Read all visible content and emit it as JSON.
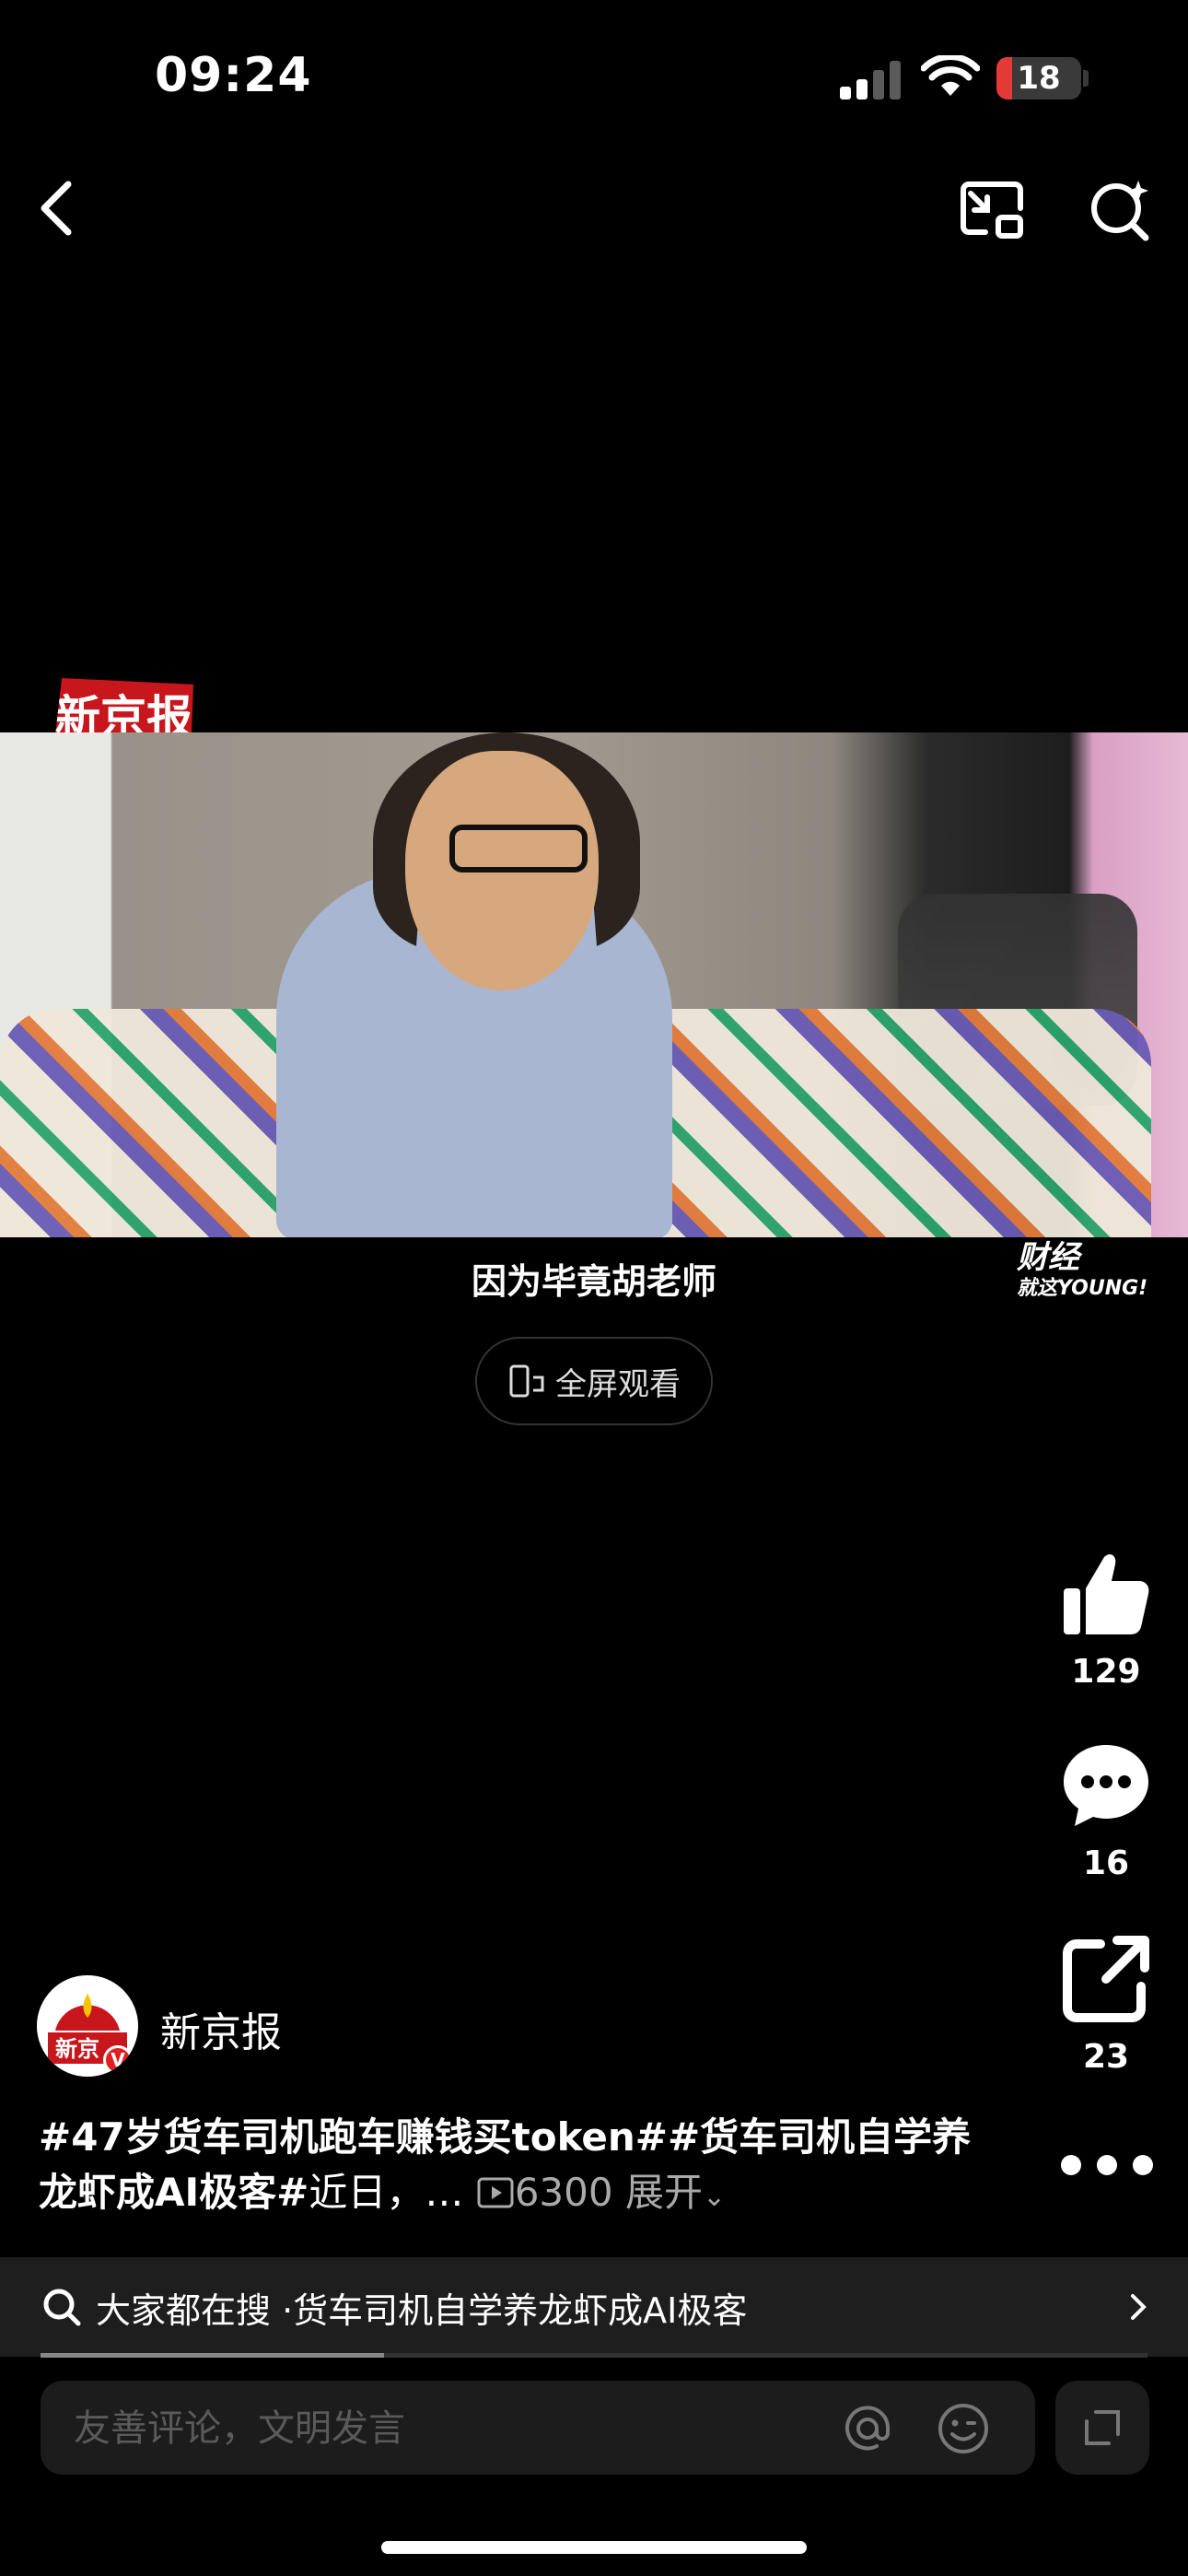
{
  "status_bar": {
    "time": "09:24",
    "battery": "18",
    "battery_level": 0.18
  },
  "video": {
    "watermark_logo": "新京报",
    "subtitle": "因为毕竟胡老师",
    "corner_logo_line1": "财经",
    "corner_logo_line2": "就这YOUNG!",
    "fullscreen_label": "全屏观看"
  },
  "actions": {
    "likes": "129",
    "comments": "16",
    "shares": "23"
  },
  "author": {
    "name": "新京报",
    "avatar_text": "新京"
  },
  "description": {
    "text_bold": "#47岁货车司机跑车赚钱买token##货车司机自学养龙虾成AI极客#",
    "text_rest": "近日，…",
    "plays": "6300",
    "expand": "展开"
  },
  "search_suggestion": {
    "prefix": "大家都在搜 · ",
    "query": "货车司机自学养龙虾成AI极客"
  },
  "progress_fraction": 0.31,
  "comment": {
    "placeholder": "友善评论，文明发言"
  },
  "colors": {
    "brand_red": "#c8161d",
    "background": "#000000",
    "battery_red": "#e53935"
  }
}
